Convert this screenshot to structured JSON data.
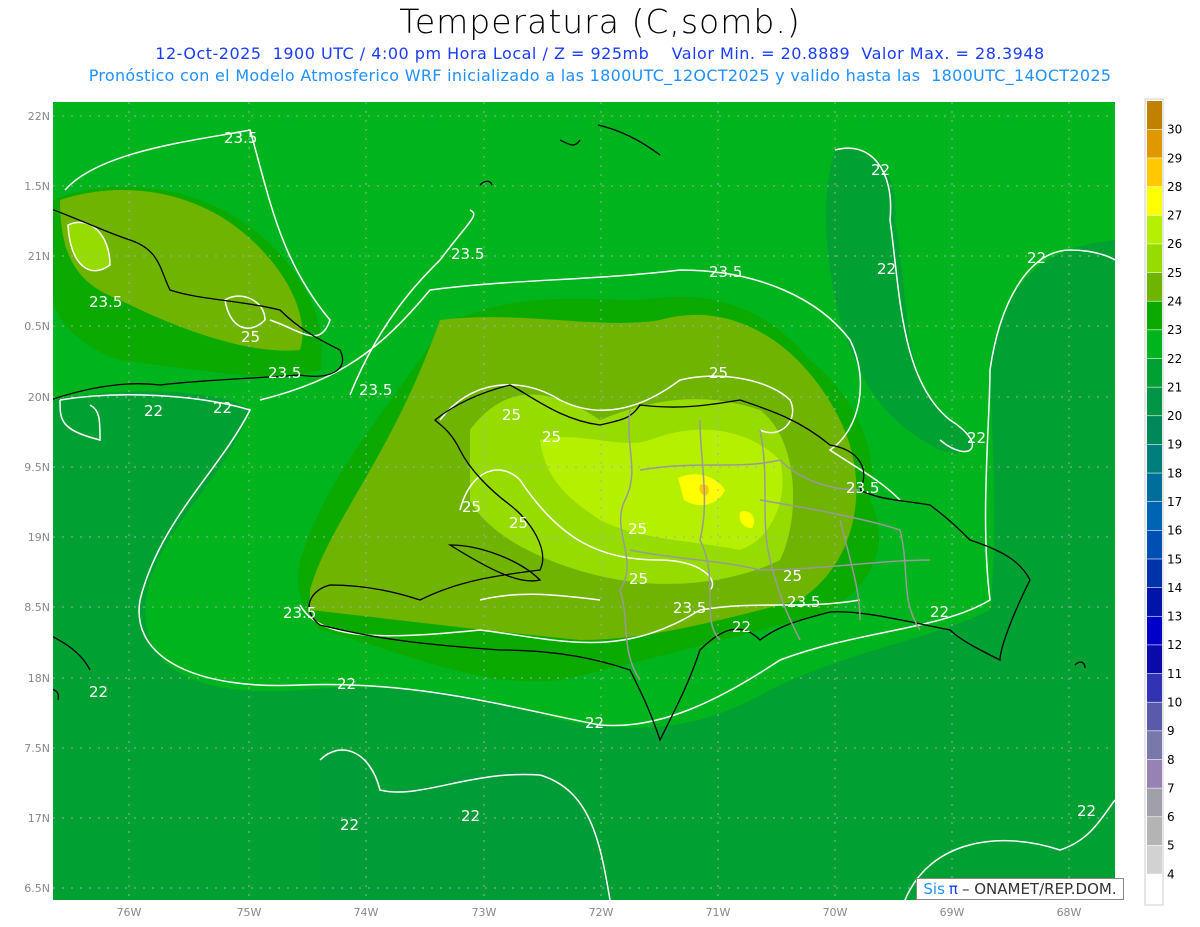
{
  "header": {
    "title": "Temperatura (C,somb.)",
    "line1": "12-Oct-2025  1900 UTC / 4:00 pm Hora Local / Z = 925mb    Valor Min. = 20.8889  Valor Max. = 28.3948",
    "line2": "Pronóstico con el Modelo Atmosferico WRF inicializado a las 1800UTC_12OCT2025 y valido hasta las  1800UTC_14OCT2025"
  },
  "map": {
    "lat_labels": [
      "22N",
      "1.5N",
      "21N",
      "0.5N",
      "20N",
      "9.5N",
      "19N",
      "8.5N",
      "18N",
      "7.5N",
      "17N",
      "6.5N"
    ],
    "lon_labels": [
      "76W",
      "75W",
      "74W",
      "73W",
      "72W",
      "71W",
      "70W",
      "69W",
      "68W"
    ],
    "contour_labels": [
      "23.5",
      "23.5",
      "23.5",
      "25",
      "23.5",
      "22",
      "22",
      "23.5",
      "23.5",
      "22",
      "22",
      "22",
      "22",
      "25",
      "25",
      "25",
      "25",
      "25",
      "25",
      "25",
      "25",
      "23.5",
      "23.5",
      "23.5",
      "23.5",
      "22",
      "22",
      "22",
      "22",
      "22",
      "22",
      "22",
      "22"
    ]
  },
  "colorbar": {
    "labels": [
      "30",
      "29",
      "28",
      "27",
      "26",
      "25",
      "24",
      "23",
      "22",
      "21",
      "20",
      "19",
      "18",
      "17",
      "16",
      "15",
      "14",
      "13",
      "12",
      "11",
      "10",
      "9",
      "8",
      "7",
      "6",
      "5",
      "4"
    ],
    "colors": [
      "#c08000",
      "#e09800",
      "#ffc800",
      "#ffff00",
      "#b4f000",
      "#96dc00",
      "#6eb400",
      "#0aaa00",
      "#00b41e",
      "#00a032",
      "#009646",
      "#00875a",
      "#007e7e",
      "#006e9a",
      "#0064b4",
      "#0050b4",
      "#0032aa",
      "#0014aa",
      "#0000c8",
      "#0a0aaa",
      "#3232b4",
      "#5a5aaa",
      "#7878aa",
      "#9682b4",
      "#a0a0aa",
      "#b4b4b4",
      "#d2d2d2",
      "#ffffff"
    ]
  },
  "credit": {
    "sis": "Sis",
    "pi": "π",
    "rest": "– ONAMET/REP.DOM."
  }
}
